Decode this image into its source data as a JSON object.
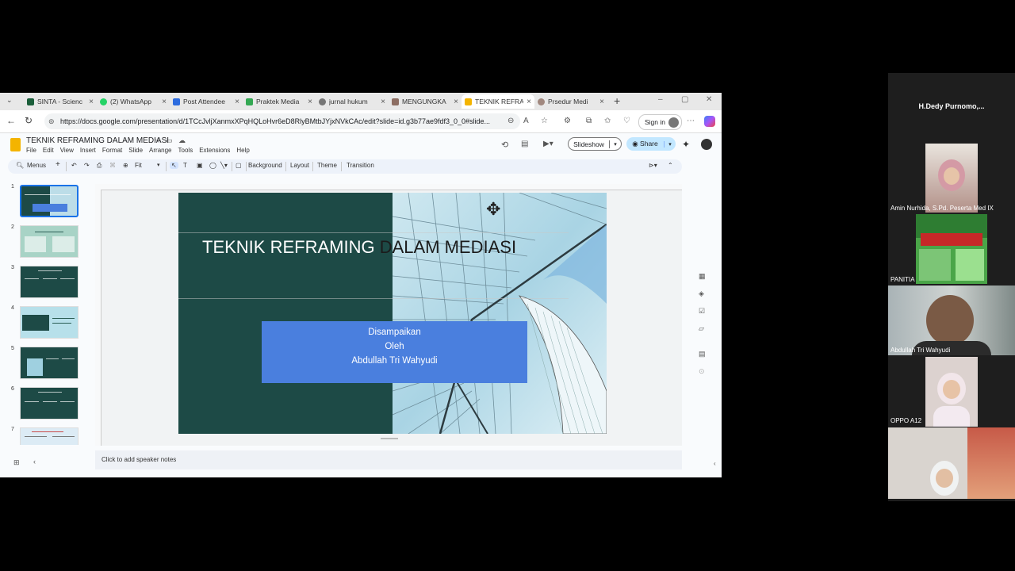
{
  "browser": {
    "tabs": [
      {
        "label": "SINTA - Scienc",
        "favicon_color": "#1a5e3a"
      },
      {
        "label": "(2) WhatsApp",
        "favicon_color": "#25d366"
      },
      {
        "label": "Post Attendee",
        "favicon_color": "#2d6cdf"
      },
      {
        "label": "Praktek Media",
        "favicon_color": "#34a853"
      },
      {
        "label": "jurnal hukum",
        "favicon_color": "#777777"
      },
      {
        "label": "MENGUNGKA",
        "favicon_color": "#8d6e63"
      },
      {
        "label": "TEKNIK REFRA",
        "favicon_color": "#f4b400"
      },
      {
        "label": "Prsedur Medi",
        "favicon_color": "#a1887f"
      }
    ],
    "url": "https://docs.google.com/presentation/d/1TCcJvljXanmxXPqHQLoHvr6eD8RlyBMtbJYjxNVkCAc/edit?slide=id.g3b77ae9fdf3_0_0#slide...",
    "sign_in": "Sign in"
  },
  "slides_app": {
    "title": "TEKNIK REFRAMING DALAM MEDIASI",
    "menu": [
      "File",
      "Edit",
      "View",
      "Insert",
      "Format",
      "Slide",
      "Arrange",
      "Tools",
      "Extensions",
      "Help"
    ],
    "slideshow": "Slideshow",
    "share": "Share",
    "toolbar": {
      "menus": "Menus",
      "zoom": "Fit",
      "background": "Background",
      "layout": "Layout",
      "theme": "Theme",
      "transition": "Transition"
    },
    "thumb_numbers": [
      "1",
      "2",
      "3",
      "4",
      "5",
      "6",
      "7"
    ],
    "notes_placeholder": "Click to add speaker notes"
  },
  "slide": {
    "title_part1": "TEKNIK REFRAMING ",
    "title_part2": "DALAM MEDIASI",
    "subtitle_lines": [
      "Disampaikan",
      "Oleh",
      "Abdullah Tri Wahyudi"
    ]
  },
  "meeting": {
    "host": "H.Dedy  Purnomo,...",
    "participants": [
      {
        "name": "Amin Nurhida, S.Pd. Peserta Med IX"
      },
      {
        "name": "PANITIA"
      },
      {
        "name": "Abdullah Tri Wahyudi"
      },
      {
        "name": "OPPO A12"
      }
    ]
  },
  "colors": {
    "slide_dark": "#1d4a46",
    "subtitle_box": "#4a7fde",
    "share_button": "#c2e7ff",
    "accent": "#1a73e8"
  }
}
